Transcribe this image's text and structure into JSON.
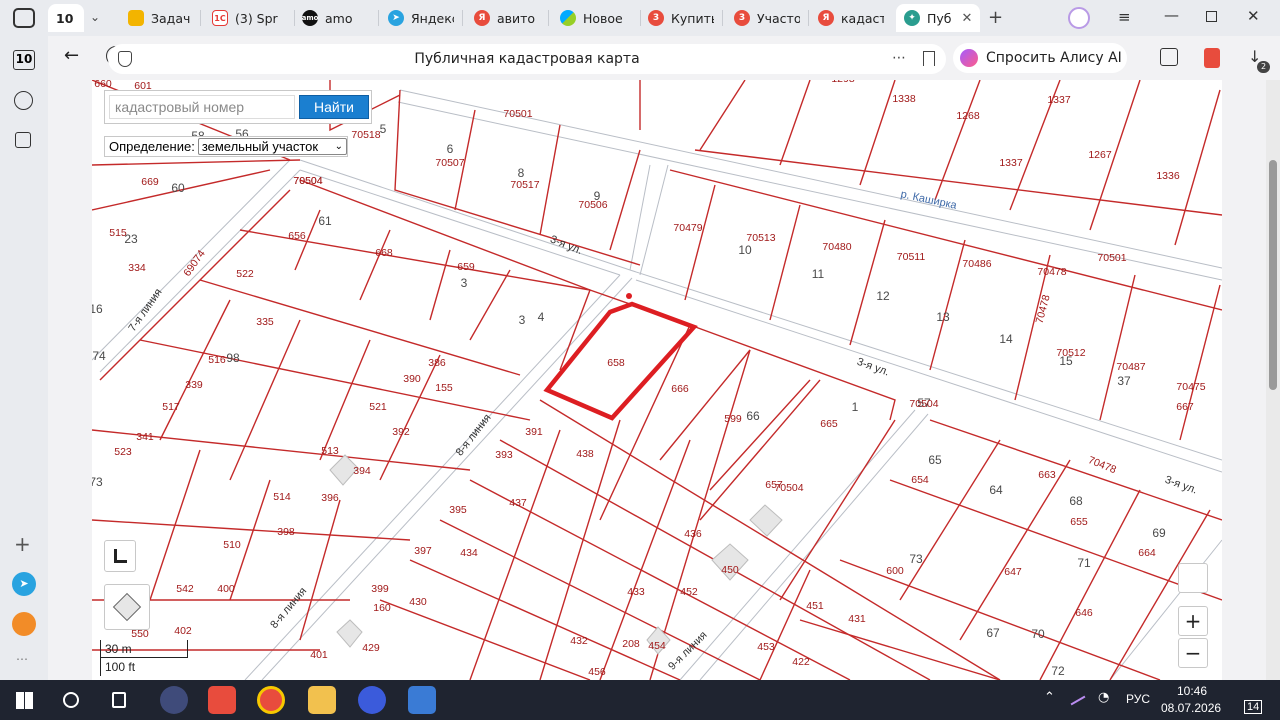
{
  "browser": {
    "tab_counter": "10",
    "tabs": [
      {
        "label": "Задач",
        "color": "#f3b400"
      },
      {
        "label": "(3) Spr",
        "color": "#e53935"
      },
      {
        "label": "amo",
        "color": "#111111"
      },
      {
        "label": "Яндекс",
        "color": "#29a3e0"
      },
      {
        "label": "авито",
        "color": "#e84c3d"
      },
      {
        "label": "Новое",
        "color": "#00aaff"
      },
      {
        "label": "Купить",
        "color": "#e84c3d"
      },
      {
        "label": "Участо",
        "color": "#e84c3d"
      },
      {
        "label": "кадаст",
        "color": "#e84c3d"
      },
      {
        "label": "Пуб",
        "color": "#2a9d8f"
      }
    ],
    "page_title": "Публичная кадастровая карта",
    "alice_label": "Спросить Алису AI",
    "downloads_badge": "2",
    "sidebar_counter": "10"
  },
  "map": {
    "search_placeholder": "кадастровый номер",
    "search_button": "Найти",
    "definition_label": "Определение:",
    "definition_value": "земельный участок",
    "scale_metric": "30 m",
    "scale_imperial": "100 ft",
    "zoom_in": "+",
    "zoom_out": "−",
    "selected_parcel": "658",
    "street_labels": [
      "р. Каширка",
      "3-я ул.",
      "3-я ул.",
      "3-я ул.",
      "7-я линия",
      "8-я линия",
      "8-я линия",
      "9-я линия"
    ],
    "parcel_numbers": [
      "660",
      "669",
      "515",
      "334",
      "16",
      "74",
      "70518",
      "70501",
      "70507",
      "70517",
      "70506",
      "70504",
      "656",
      "668",
      "659",
      "522",
      "335",
      "516",
      "339",
      "517",
      "523",
      "341",
      "513",
      "514",
      "510",
      "542",
      "550",
      "386",
      "390",
      "155",
      "521",
      "392",
      "391",
      "393",
      "394",
      "396",
      "398",
      "400",
      "402",
      "401",
      "395",
      "397",
      "399",
      "160",
      "430",
      "429",
      "437",
      "434",
      "438",
      "433",
      "432",
      "208",
      "454",
      "456",
      "436",
      "450",
      "452",
      "451",
      "453",
      "431",
      "422",
      "600",
      "599",
      "666",
      "657",
      "665",
      "70513",
      "70480",
      "70479",
      "70511",
      "70486",
      "70478",
      "70512",
      "70487",
      "70475",
      "70501",
      "1298",
      "1338",
      "1268",
      "1337",
      "1337",
      "1267",
      "1336",
      "663",
      "654",
      "655",
      "664",
      "647",
      "646",
      "67",
      "72",
      "73",
      "71",
      "70",
      "69",
      "68",
      "64",
      "65",
      "66",
      "70504",
      "1",
      "57",
      "601",
      "56",
      "58",
      "60",
      "61",
      "3",
      "4",
      "5",
      "6",
      "8",
      "9",
      "10",
      "11",
      "12",
      "13",
      "14",
      "15",
      "37",
      "667",
      "98",
      "3",
      "23",
      "73"
    ],
    "codes": [
      "69074",
      "70504",
      "70504",
      "70478"
    ]
  },
  "taskbar": {
    "language": "РУС",
    "time": "10:46",
    "date": "08.07.2026",
    "notifications": "14"
  },
  "colors": {
    "parcel_line": "#c42a2a",
    "selection": "#dd1e22",
    "search_button": "#1b7fd0"
  }
}
